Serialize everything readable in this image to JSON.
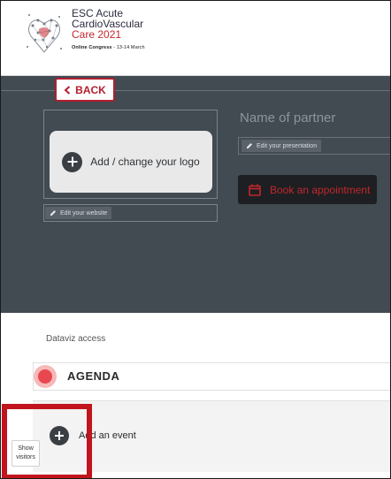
{
  "header": {
    "logo_line1": "ESC Acute",
    "logo_line2": "CardioVascular",
    "logo_line3": "Care 2021",
    "logo_sub_bold": "Online Congress",
    "logo_sub_rest": " - 13-14 March"
  },
  "partner": {
    "back_label": "BACK",
    "logo_action": "Add / change your logo",
    "edit_website": "Edit your website",
    "name": "Name of partner",
    "edit_presentation": "Edit your presentation",
    "book_appointment": "Book an appointment"
  },
  "content": {
    "dataviz_label": "Dataviz access",
    "agenda_title": "AGENDA",
    "add_event": "Add an event"
  },
  "overlay": {
    "show_visitors": "Show visitors"
  },
  "colors": {
    "brand_red": "#c2272d",
    "panel_dark": "#424a52",
    "highlight_red": "#c1141c",
    "agenda_dot": "#e8474f"
  },
  "icons": [
    "chevron-left-icon",
    "plus-circle-icon",
    "pencil-icon",
    "calendar-icon",
    "logo-heart-network-icon"
  ]
}
